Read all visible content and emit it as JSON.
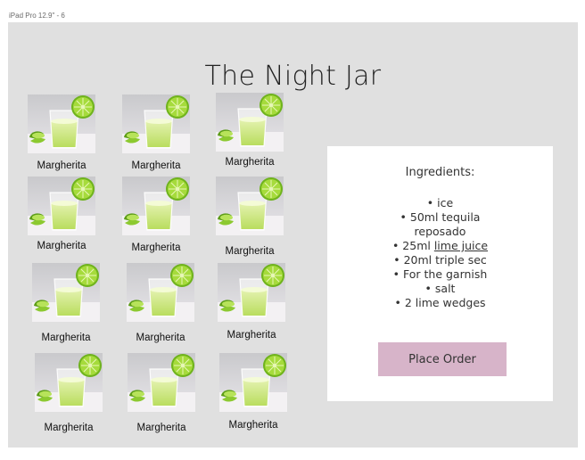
{
  "frame_label": "iPad Pro 12.9\" - 6",
  "title": "The Night Jar",
  "products": [
    {
      "name": "Margherita",
      "image": "margarita-cocktail-image"
    },
    {
      "name": "Margherita",
      "image": "margarita-cocktail-image"
    },
    {
      "name": "Margherita",
      "image": "margarita-cocktail-image"
    },
    {
      "name": "Margherita",
      "image": "margarita-cocktail-image"
    },
    {
      "name": "Margherita",
      "image": "margarita-cocktail-image"
    },
    {
      "name": "Margherita",
      "image": "margarita-cocktail-image"
    },
    {
      "name": "Margherita",
      "image": "margarita-cocktail-image"
    },
    {
      "name": "Margherita",
      "image": "margarita-cocktail-image"
    },
    {
      "name": "Margherita",
      "image": "margarita-cocktail-image"
    },
    {
      "name": "Margherita",
      "image": "margarita-cocktail-image"
    },
    {
      "name": "Margherita",
      "image": "margarita-cocktail-image"
    },
    {
      "name": "Margherita",
      "image": "margarita-cocktail-image"
    }
  ],
  "ingredients": {
    "heading": "Ingredients:",
    "items": [
      {
        "pre": "ice",
        "link": "",
        "post": ""
      },
      {
        "pre": "50ml tequila reposado",
        "link": "",
        "post": ""
      },
      {
        "pre": "25ml ",
        "link": "lime juice",
        "post": ""
      },
      {
        "pre": "20ml triple sec",
        "link": "",
        "post": ""
      },
      {
        "pre": "For the garnish",
        "link": "",
        "post": ""
      },
      {
        "pre": "salt",
        "link": "",
        "post": ""
      },
      {
        "pre": "2 lime wedges",
        "link": "",
        "post": ""
      }
    ]
  },
  "order_button": "Place Order",
  "colors": {
    "button": "#d7b4c9",
    "artboard": "#e0e0e0",
    "lime": "#8fd22a"
  }
}
